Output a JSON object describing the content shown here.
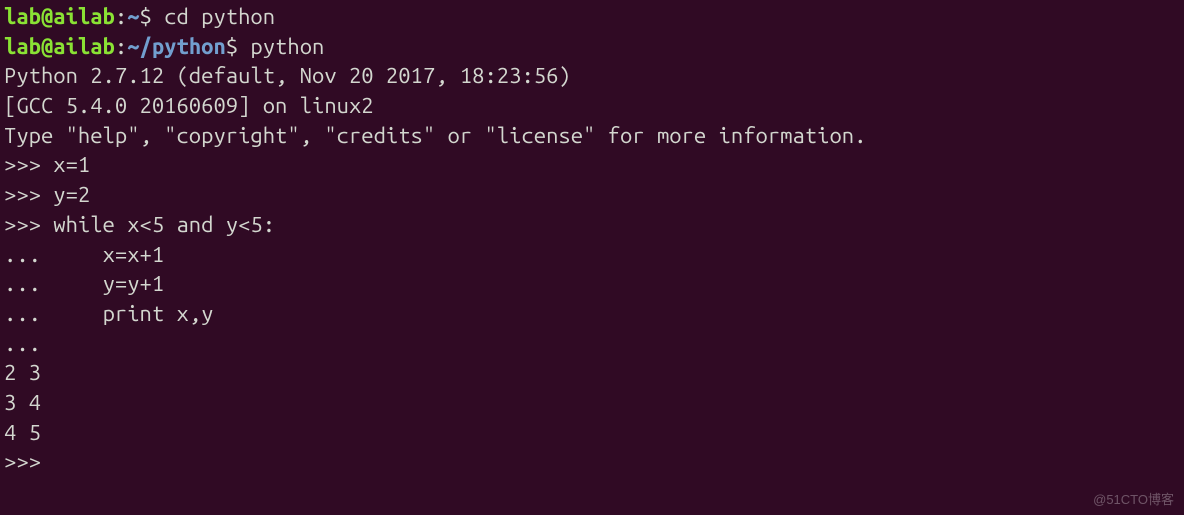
{
  "lines": {
    "l1": {
      "userhost": "lab@ailab",
      "colon": ":",
      "path": "~",
      "dollar": "$ ",
      "cmd": "cd python"
    },
    "l2": {
      "userhost": "lab@ailab",
      "colon": ":",
      "path": "~/python",
      "dollar": "$ ",
      "cmd": "python"
    },
    "l3": "Python 2.7.12 (default, Nov 20 2017, 18:23:56)",
    "l4": "[GCC 5.4.0 20160609] on linux2",
    "l5": "Type \"help\", \"copyright\", \"credits\" or \"license\" for more information.",
    "l6_prompt": ">>> ",
    "l6_cmd": "x=1",
    "l7_prompt": ">>> ",
    "l7_cmd": "y=2",
    "l8_prompt": ">>> ",
    "l8_cmd": "while x<5 and y<5:",
    "l9_prompt": "...     ",
    "l9_cmd": "x=x+1",
    "l10_prompt": "...     ",
    "l10_cmd": "y=y+1",
    "l11_prompt": "...     ",
    "l11_cmd": "print x,y",
    "l12": "...",
    "l13": "2 3",
    "l14": "3 4",
    "l15": "4 5",
    "l16": ">>>"
  },
  "watermark": "@51CTO博客"
}
